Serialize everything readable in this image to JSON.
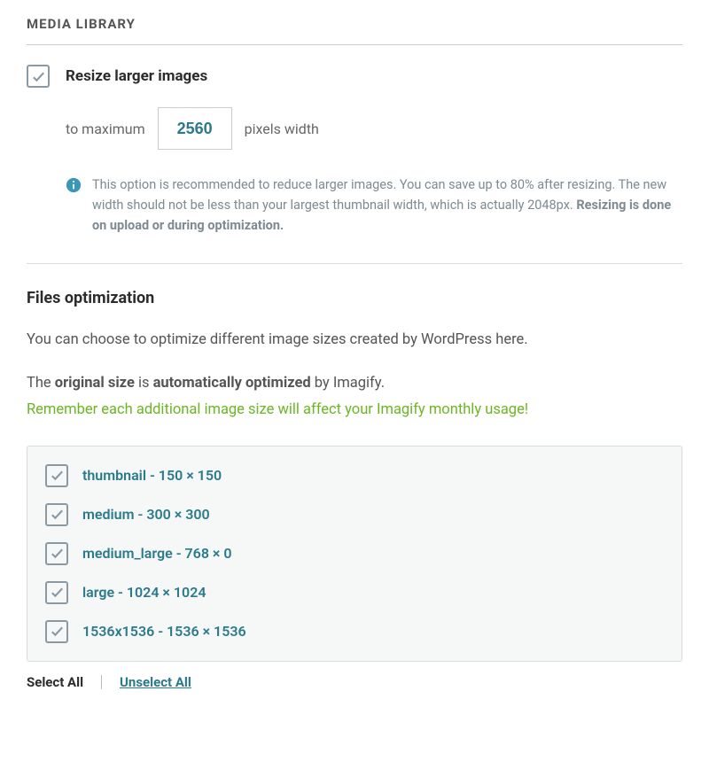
{
  "header": {
    "title": "MEDIA LIBRARY"
  },
  "resize": {
    "checkbox_label": "Resize larger images",
    "max_prefix": "to maximum",
    "max_value": "2560",
    "max_suffix": "pixels width",
    "info_part1": "This option is recommended to reduce larger images. You can save up to 80% after resizing. The new width should not be less than your largest thumbnail width, which is actually 2048px. ",
    "info_bold": "Resizing is done on upload or during optimization."
  },
  "filesOpt": {
    "heading": "Files optimization",
    "intro": "You can choose to optimize different image sizes created by WordPress here.",
    "line2_prefix": "The ",
    "line2_b1": "original size",
    "line2_mid": " is ",
    "line2_b2": "automatically optimized",
    "line2_suffix": " by Imagify.",
    "warning": "Remember each additional image size will affect your Imagify monthly usage!"
  },
  "sizes": [
    {
      "label": "thumbnail - 150 × 150"
    },
    {
      "label": "medium - 300 × 300"
    },
    {
      "label": "medium_large - 768 × 0"
    },
    {
      "label": "large - 1024 × 1024"
    },
    {
      "label": "1536x1536 - 1536 × 1536"
    }
  ],
  "actions": {
    "select_all": "Select All",
    "unselect_all": "Unselect All"
  }
}
